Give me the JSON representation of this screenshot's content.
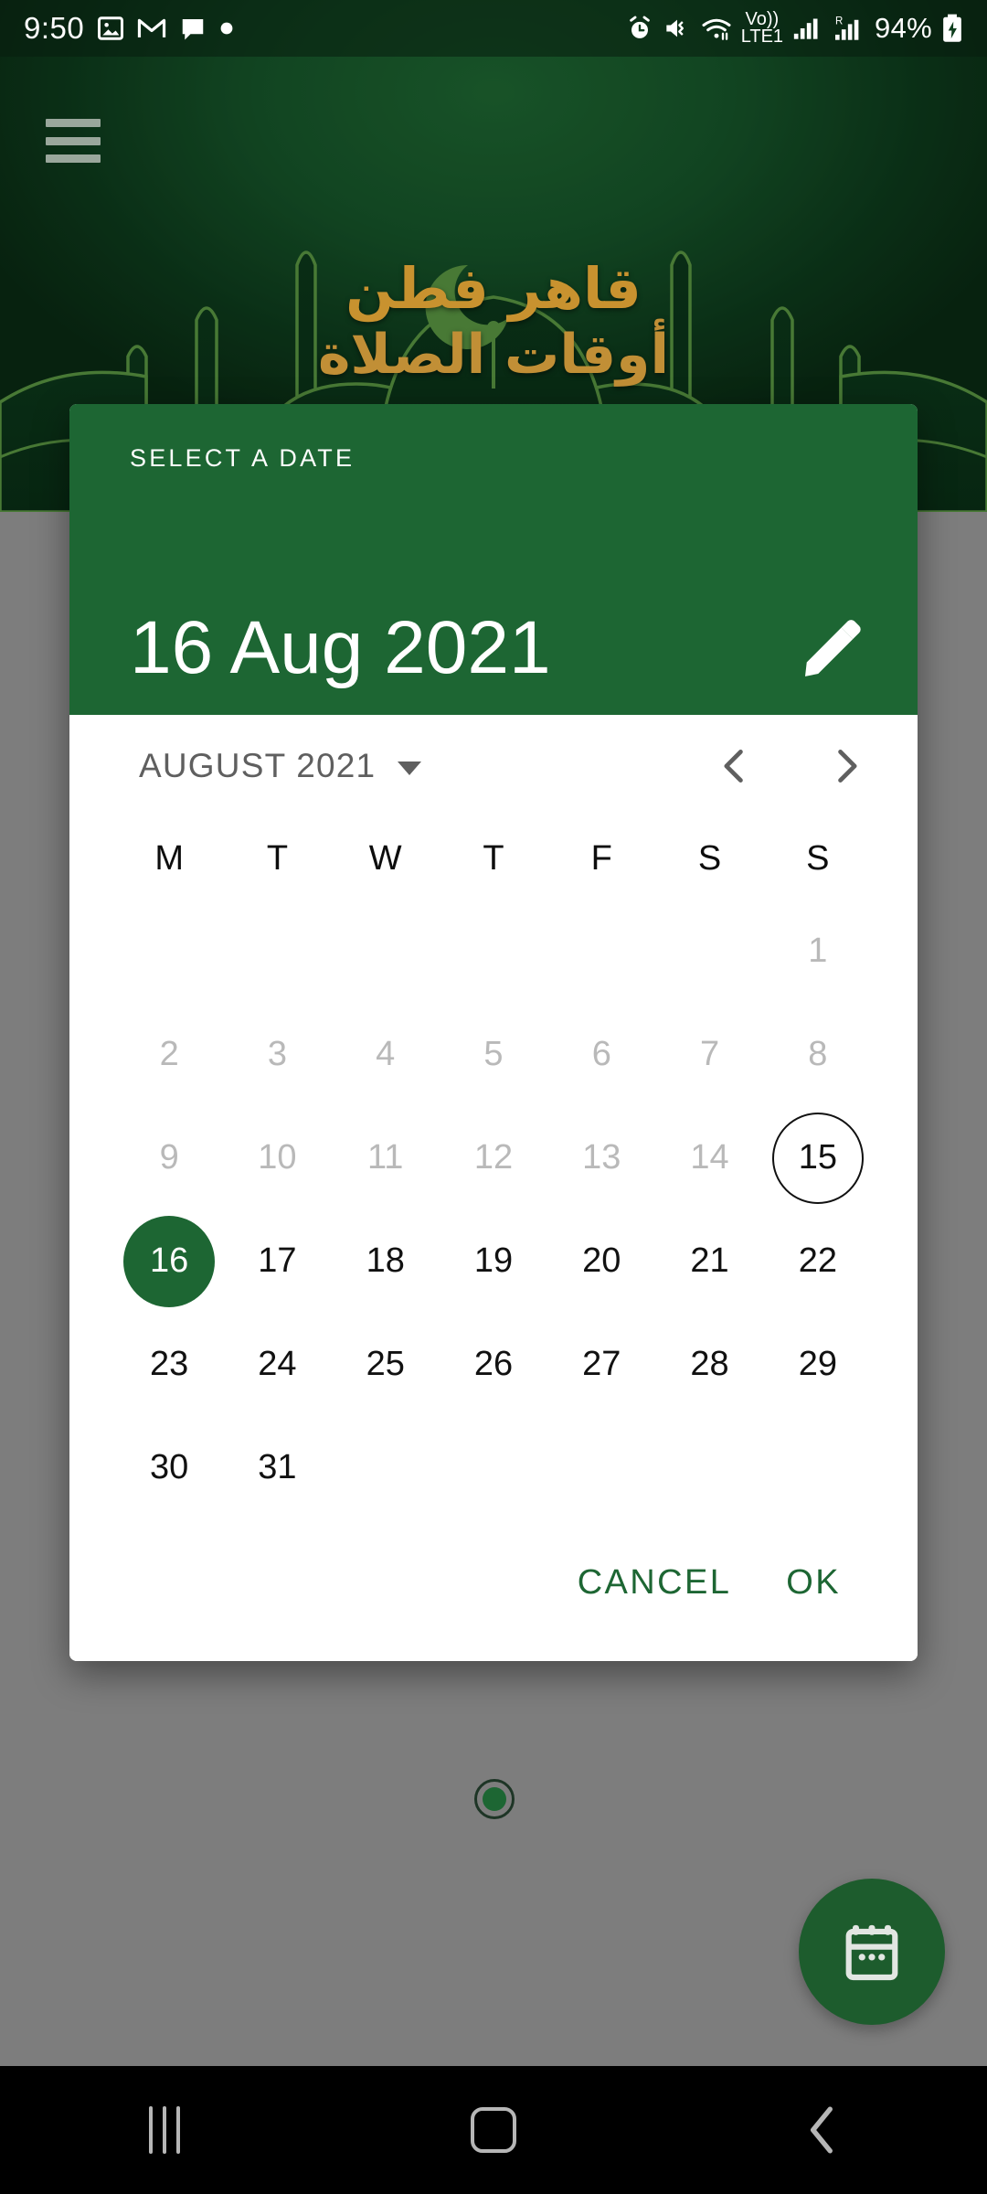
{
  "status_bar": {
    "time": "9:50",
    "battery": "94%",
    "left_icons": [
      "photos-icon",
      "gmail-icon",
      "message-icon",
      "dot-icon"
    ],
    "right_icons": [
      "alarm-icon",
      "mute-vibrate-icon",
      "wifi-icon",
      "volte-icon",
      "signal-icon",
      "roaming-signal-icon",
      "battery-charging-icon"
    ],
    "network_label": "Vo))",
    "network_sub": "LTE1",
    "roaming_label": "R"
  },
  "app": {
    "menu_icon": "hamburger-menu-icon",
    "title_ar": "قاهر فطن",
    "subtitle_ar": "أوقات الصلاة",
    "fab_icon": "calendar-icon",
    "page_indicator": "page-dot-indicator"
  },
  "dialog": {
    "overline": "SELECT A DATE",
    "selected_date_display": "16 Aug 2021",
    "edit_icon": "pencil-icon",
    "month_label": "AUGUST 2021",
    "dropdown_icon": "chevron-down-icon",
    "prev_icon": "chevron-left-icon",
    "next_icon": "chevron-right-icon",
    "weekdays": [
      "M",
      "T",
      "W",
      "T",
      "F",
      "S",
      "S"
    ],
    "weeks": [
      [
        {
          "day": "",
          "state": "empty"
        },
        {
          "day": "",
          "state": "empty"
        },
        {
          "day": "",
          "state": "empty"
        },
        {
          "day": "",
          "state": "empty"
        },
        {
          "day": "",
          "state": "empty"
        },
        {
          "day": "",
          "state": "empty"
        },
        {
          "day": "1",
          "state": "dim"
        }
      ],
      [
        {
          "day": "2",
          "state": "dim"
        },
        {
          "day": "3",
          "state": "dim"
        },
        {
          "day": "4",
          "state": "dim"
        },
        {
          "day": "5",
          "state": "dim"
        },
        {
          "day": "6",
          "state": "dim"
        },
        {
          "day": "7",
          "state": "dim"
        },
        {
          "day": "8",
          "state": "dim"
        }
      ],
      [
        {
          "day": "9",
          "state": "dim"
        },
        {
          "day": "10",
          "state": "dim"
        },
        {
          "day": "11",
          "state": "dim"
        },
        {
          "day": "12",
          "state": "dim"
        },
        {
          "day": "13",
          "state": "dim"
        },
        {
          "day": "14",
          "state": "dim"
        },
        {
          "day": "15",
          "state": "today"
        }
      ],
      [
        {
          "day": "16",
          "state": "selected"
        },
        {
          "day": "17",
          "state": "normal"
        },
        {
          "day": "18",
          "state": "normal"
        },
        {
          "day": "19",
          "state": "normal"
        },
        {
          "day": "20",
          "state": "normal"
        },
        {
          "day": "21",
          "state": "normal"
        },
        {
          "day": "22",
          "state": "normal"
        }
      ],
      [
        {
          "day": "23",
          "state": "normal"
        },
        {
          "day": "24",
          "state": "normal"
        },
        {
          "day": "25",
          "state": "normal"
        },
        {
          "day": "26",
          "state": "normal"
        },
        {
          "day": "27",
          "state": "normal"
        },
        {
          "day": "28",
          "state": "normal"
        },
        {
          "day": "29",
          "state": "normal"
        }
      ],
      [
        {
          "day": "30",
          "state": "normal"
        },
        {
          "day": "31",
          "state": "normal"
        },
        {
          "day": "",
          "state": "empty"
        },
        {
          "day": "",
          "state": "empty"
        },
        {
          "day": "",
          "state": "empty"
        },
        {
          "day": "",
          "state": "empty"
        },
        {
          "day": "",
          "state": "empty"
        }
      ]
    ],
    "cancel_label": "CANCEL",
    "ok_label": "OK"
  },
  "nav_bar": {
    "recents_icon": "recents-icon",
    "home_icon": "home-icon",
    "back_icon": "back-icon"
  },
  "colors": {
    "dialog_green": "#1d6633",
    "app_dark_green": "#0e3d1d",
    "gold": "#c8922f",
    "scrim_grey": "#7d7d7d",
    "dim_text": "#b9b9b9"
  }
}
